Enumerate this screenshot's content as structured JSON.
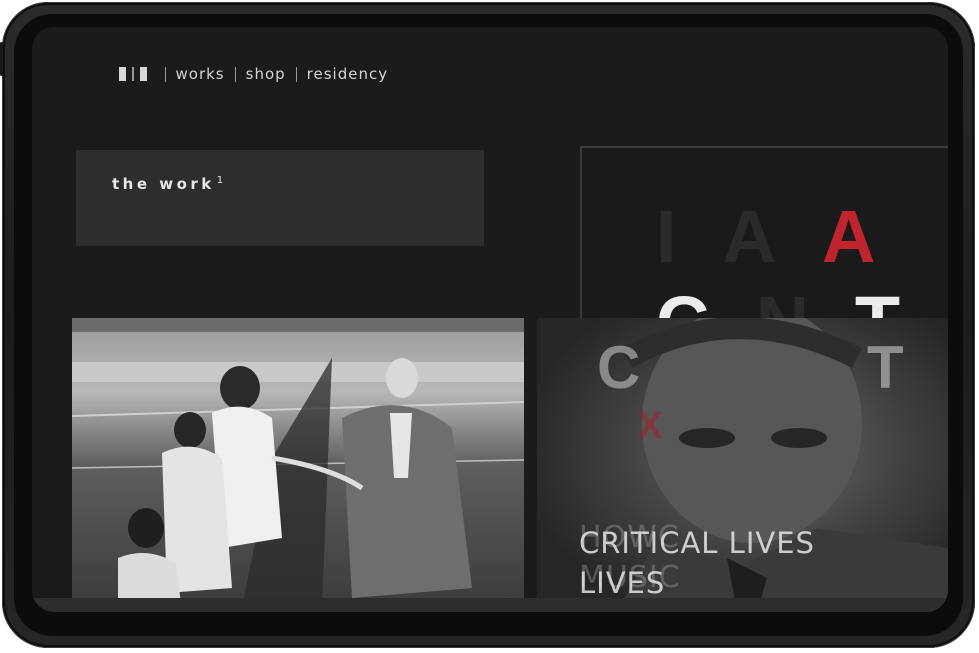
{
  "nav": {
    "items": [
      {
        "label": "works"
      },
      {
        "label": "shop"
      },
      {
        "label": "residency"
      }
    ]
  },
  "hero": {
    "title": "the work",
    "footnote": "1"
  },
  "cover": {
    "row1": [
      "I",
      "A",
      "A"
    ],
    "row2": [
      "C",
      "N",
      "T"
    ],
    "faint_line1": "HOWC",
    "faint_line2": "MUSIC",
    "caption_line1": "CRITICAL LIVES",
    "caption_line2": "LIVES"
  },
  "colors": {
    "background": "#1b1b1c",
    "panel": "#2d2d2e",
    "accent_red": "#c0242f",
    "text": "#d4d4d4"
  }
}
